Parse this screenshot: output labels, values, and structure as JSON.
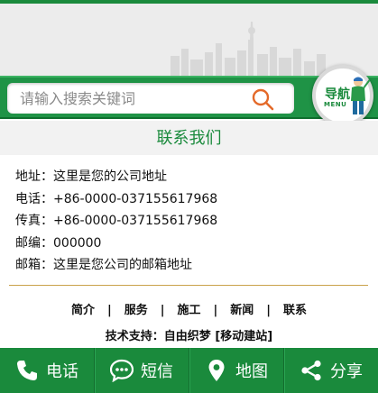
{
  "search": {
    "placeholder": "请输入搜索关键词"
  },
  "nav_badge": {
    "main": "导航",
    "sub": "MENU"
  },
  "contact": {
    "title": "联系我们",
    "rows": [
      {
        "label": "地址：",
        "value": "这里是您的公司地址"
      },
      {
        "label": "电话：",
        "value": "+86-0000-037155617968"
      },
      {
        "label": "传真：",
        "value": "+86-0000-037155617968"
      },
      {
        "label": "邮编：",
        "value": "000000"
      },
      {
        "label": "邮箱：",
        "value": "这里是您公司的邮箱地址"
      }
    ]
  },
  "footer": {
    "links": [
      "简介",
      "服务",
      "施工",
      "新闻",
      "联系"
    ],
    "separator": "|",
    "support_prefix": "技术支持：",
    "support_link": "自由织梦",
    "support_suffix": "[移动建站]"
  },
  "bottom_bar": {
    "items": [
      {
        "label": "电话",
        "icon": "phone-icon"
      },
      {
        "label": "短信",
        "icon": "message-icon"
      },
      {
        "label": "地图",
        "icon": "map-pin-icon"
      },
      {
        "label": "分享",
        "icon": "share-icon"
      }
    ]
  },
  "colors": {
    "brand_green": "#1a8a3c",
    "search_icon": "#e46a2a",
    "divider_gold": "#c9a24a"
  }
}
